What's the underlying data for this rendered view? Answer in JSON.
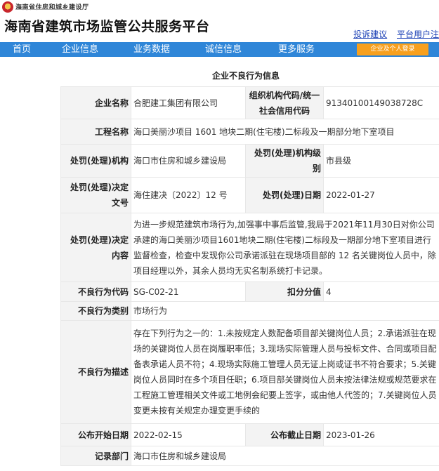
{
  "header": {
    "dept_name": "海南省住房和城乡建设厅",
    "site_title": "海南省建筑市场监管公共服务平台",
    "links": [
      "投诉建议",
      "平台用户注"
    ]
  },
  "nav": {
    "items": [
      "首页",
      "企业信息",
      "业务数据",
      "诚信信息",
      "更多服务"
    ],
    "login": "企业及个人登录"
  },
  "colors": {
    "nav_bg": "#2f86d8",
    "login_bg": "#f7a01e",
    "label_bg": "#f3f3f3"
  },
  "section_title": "企业不良行为信息",
  "rows": {
    "company_label": "企业名称",
    "company_value": "合肥建工集团有限公司",
    "org_code_label": "组织机构代码/统一社会信用代码",
    "org_code_value": "91340100149038728C",
    "project_label": "工程名称",
    "project_value": "海口美丽沙项目 1601 地块二期(住宅楼)二标段及一期部分地下室项目",
    "agency_label": "处罚(处理)机构",
    "agency_value": "海口市住房和城乡建设局",
    "agency_level_label": "处罚(处理)机构级别",
    "agency_level_value": "市县级",
    "decision_no_label": "处罚(处理)决定文号",
    "decision_no_value": "海住建决〔2022〕12 号",
    "decision_date_label": "处罚(处理)日期",
    "decision_date_value": "2022-01-27",
    "decision_content_label": "处罚(处理)决定内容",
    "decision_content_value": "为进一步规范建筑市场行为,加强事中事后监管,我局于2021年11月30日对你公司承建的海口美丽沙项目1601地块二期(住宅楼)二标段及一期部分地下室项目进行监督检查，检查中发现你公司承诺派驻在现场项目部的 12 名关键岗位人员中，除项目经理以外，其余人员均无实名制系统打卡记录。",
    "behavior_code_label": "不良行为代码",
    "behavior_code_value": "SG-C02-21",
    "deduction_label": "扣分分值",
    "deduction_value": "4",
    "category_label": "不良行为类别",
    "category_value": "市场行为",
    "description_label": "不良行为描述",
    "description_value": "存在下列行为之一的：1.未按规定人数配备项目部关键岗位人员；2.承诺派驻在现场的关键岗位人员在岗履职率低；3.现场实际管理人员与投标文件、合同或项目配备表承诺人员不符；4.现场实际施工管理人员无证上岗或证书不符合要求；5.关键岗位人员同时在多个项目任职；6.项目部关键岗位人员未按法律法规或规范要求在工程施工管理相关文件或工地例会纪要上签字，或由他人代签的；7.关键岗位人员变更未按有关规定办理变更手续的",
    "publish_start_label": "公布开始日期",
    "publish_start_value": "2022-02-15",
    "publish_end_label": "公布截止日期",
    "publish_end_value": "2023-01-26",
    "record_dept_label": "记录部门",
    "record_dept_value": "海口市住房和城乡建设局"
  }
}
